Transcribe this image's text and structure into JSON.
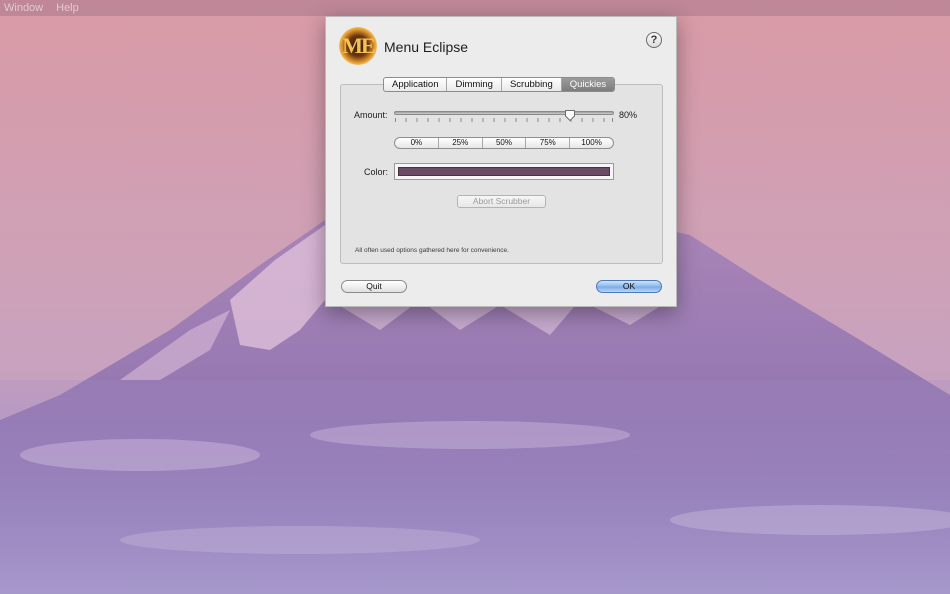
{
  "menubar": {
    "items": [
      "Window",
      "Help"
    ]
  },
  "dialog": {
    "app_icon_letters": "ME",
    "title": "Menu Eclipse",
    "help_label": "?",
    "tabs": [
      {
        "label": "Application",
        "active": false
      },
      {
        "label": "Dimming",
        "active": false
      },
      {
        "label": "Scrubbing",
        "active": false
      },
      {
        "label": "Quickies",
        "active": true
      }
    ],
    "amount": {
      "label": "Amount:",
      "value_text": "80%",
      "value_fraction": 0.8
    },
    "presets": [
      "0%",
      "25%",
      "50%",
      "75%",
      "100%"
    ],
    "color": {
      "label": "Color:",
      "value": "#6b4a64"
    },
    "abort_button": "Abort Scrubber",
    "footnote": "All often used options gathered here for convenience.",
    "quit_button": "Quit",
    "ok_button": "OK"
  },
  "colors": {
    "accent_button": "#7aaae6",
    "swatch": "#6b4a64"
  }
}
